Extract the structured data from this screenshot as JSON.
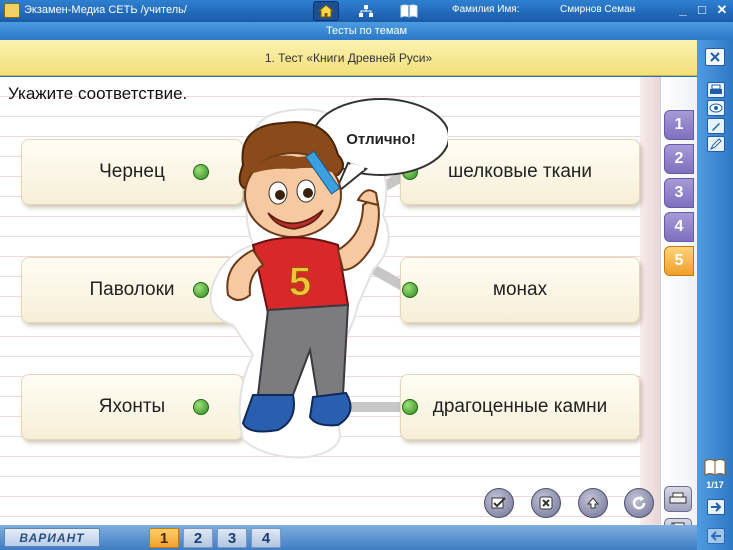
{
  "app": {
    "title": "Экзамен-Медиа СЕТЬ /учитель/",
    "user_label": "Фамилия Имя:",
    "user_name": "Смирнов Семан",
    "minimize": "_",
    "restore": "□",
    "close": "✕"
  },
  "section": {
    "title": "Тесты по темам"
  },
  "test": {
    "title": "1. Тест «Книги Древней Руси»",
    "question": "Укажите соответствие."
  },
  "pairs": {
    "left": [
      "Чернец",
      "Паволоки",
      "Яхонты"
    ],
    "right": [
      "шелковые ткани",
      "монах",
      "драгоценные камни"
    ]
  },
  "feedback": {
    "bubble": "Отлично!",
    "shirt_number": "5"
  },
  "question_tabs": [
    {
      "label": "1",
      "active": false
    },
    {
      "label": "2",
      "active": false
    },
    {
      "label": "3",
      "active": false
    },
    {
      "label": "4",
      "active": false
    },
    {
      "label": "5",
      "active": true
    }
  ],
  "counter": {
    "text": "1/17"
  },
  "variant": {
    "label": "ВАРИАНТ",
    "buttons": [
      {
        "label": "1",
        "active": true
      },
      {
        "label": "2",
        "active": false
      },
      {
        "label": "3",
        "active": false
      },
      {
        "label": "4",
        "active": false
      }
    ]
  },
  "icons": {
    "home": "home-icon",
    "tree": "hierarchy-icon",
    "book": "book-icon",
    "print": "print-icon",
    "eye": "eye-icon",
    "edit": "edit-icon",
    "pen": "pen-icon",
    "close": "close-icon",
    "next": "arrow-right-icon",
    "prev": "arrow-left-icon"
  },
  "colors": {
    "accent_blue": "#2b78c8",
    "active_tab": "#f0a02a",
    "tab": "#7e70bf",
    "link_dot": "#2f8a1f"
  }
}
